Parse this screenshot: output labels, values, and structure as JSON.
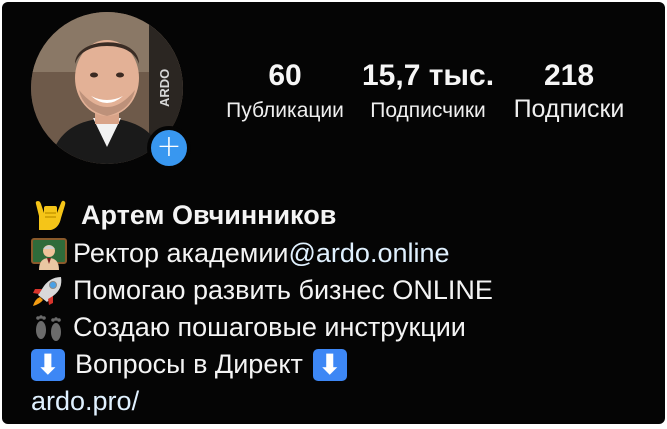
{
  "profile": {
    "avatar_icon": "profile-photo",
    "add_icon": "plus-icon",
    "add_symbol": "+",
    "avatar_text": "ARDO"
  },
  "stats": {
    "posts": {
      "value": "60",
      "label": "Публикации"
    },
    "followers": {
      "value": "15,7 тыс.",
      "label": "Подписчики"
    },
    "following": {
      "value": "218",
      "label": "Подписки"
    }
  },
  "bio": {
    "name": "Артем Овчинников",
    "name_icon": "sign-of-the-horns-emoji",
    "line1_text": "Ректор академии ",
    "line1_mention": "@ardo.online",
    "line1_icon": "teacher-emoji",
    "line2_text": "Помогаю развить бизнес ONLINE",
    "line2_icon": "rocket-emoji",
    "line3_text": "Создаю пошаговые инструкции",
    "line3_icon": "footprints-emoji",
    "line4_text": "Вопросы в Директ",
    "line4_icon": "down-arrow-emoji",
    "arrow_symbol": "⬇",
    "website": "ardo.pro/"
  },
  "colors": {
    "background": "#050505",
    "accent_blue": "#3897f0",
    "link": "#e0f1ff"
  }
}
